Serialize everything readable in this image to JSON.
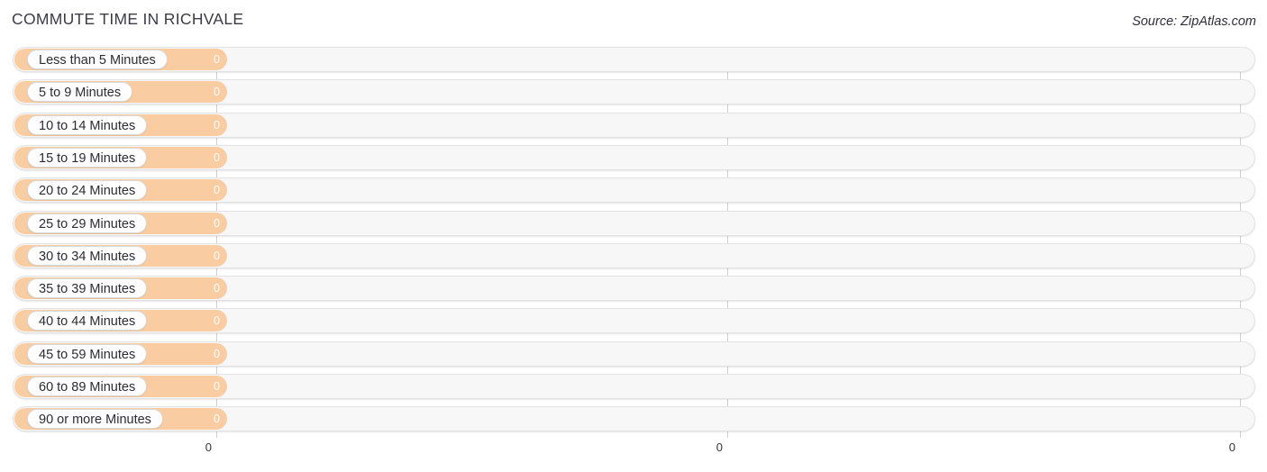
{
  "header": {
    "title": "COMMUTE TIME IN RICHVALE",
    "source": "Source: ZipAtlas.com"
  },
  "colors": {
    "bar": "#f9cda1",
    "track": "#f7f7f7",
    "gridline": "#cfcfcf",
    "title_text": "#3c3c46",
    "value_text": "#ffffff"
  },
  "chart_data": {
    "type": "bar",
    "orientation": "horizontal",
    "title": "COMMUTE TIME IN RICHVALE",
    "xlabel": "",
    "ylabel": "",
    "grid": true,
    "legend": null,
    "xlim": [
      0,
      0
    ],
    "axis_ticks": [
      "0",
      "0",
      "0"
    ],
    "categories": [
      "Less than 5 Minutes",
      "5 to 9 Minutes",
      "10 to 14 Minutes",
      "15 to 19 Minutes",
      "20 to 24 Minutes",
      "25 to 29 Minutes",
      "30 to 34 Minutes",
      "35 to 39 Minutes",
      "40 to 44 Minutes",
      "45 to 59 Minutes",
      "60 to 89 Minutes",
      "90 or more Minutes"
    ],
    "values": [
      0,
      0,
      0,
      0,
      0,
      0,
      0,
      0,
      0,
      0,
      0,
      0
    ],
    "value_labels": [
      "0",
      "0",
      "0",
      "0",
      "0",
      "0",
      "0",
      "0",
      "0",
      "0",
      "0",
      "0"
    ]
  },
  "rows": [
    {
      "label": "Less than 5 Minutes",
      "value": "0"
    },
    {
      "label": "5 to 9 Minutes",
      "value": "0"
    },
    {
      "label": "10 to 14 Minutes",
      "value": "0"
    },
    {
      "label": "15 to 19 Minutes",
      "value": "0"
    },
    {
      "label": "20 to 24 Minutes",
      "value": "0"
    },
    {
      "label": "25 to 29 Minutes",
      "value": "0"
    },
    {
      "label": "30 to 34 Minutes",
      "value": "0"
    },
    {
      "label": "35 to 39 Minutes",
      "value": "0"
    },
    {
      "label": "40 to 44 Minutes",
      "value": "0"
    },
    {
      "label": "45 to 59 Minutes",
      "value": "0"
    },
    {
      "label": "60 to 89 Minutes",
      "value": "0"
    },
    {
      "label": "90 or more Minutes",
      "value": "0"
    }
  ],
  "axis": {
    "ticks": [
      {
        "label": "0"
      },
      {
        "label": "0"
      },
      {
        "label": "0"
      }
    ]
  }
}
